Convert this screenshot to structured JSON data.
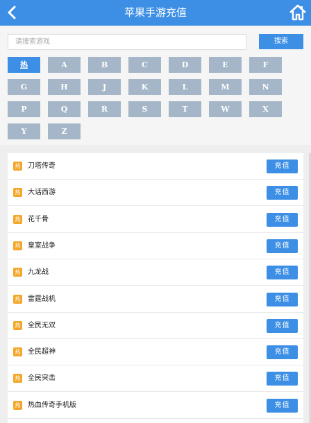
{
  "header": {
    "title": "苹果手游充值",
    "back_icon": "chevron-left-icon",
    "home_icon": "home-icon"
  },
  "search": {
    "placeholder": "请搜索游戏",
    "button_label": "搜索"
  },
  "letters": [
    "热",
    "A",
    "B",
    "C",
    "D",
    "E",
    "F",
    "G",
    "H",
    "J",
    "K",
    "L",
    "M",
    "N",
    "P",
    "Q",
    "R",
    "S",
    "T",
    "W",
    "X",
    "Y",
    "Z"
  ],
  "active_letter": "热",
  "games": {
    "hot_badge": "热",
    "recharge_label": "充值",
    "items": [
      "刀塔传奇",
      "大话西游",
      "花千骨",
      "皇室战争",
      "九龙战",
      "雷霆战机",
      "全民无双",
      "全民超神",
      "全民突击",
      "热血传奇手机版"
    ]
  },
  "colors": {
    "primary": "#3d8fe6",
    "letter_bg": "#a4b6c7",
    "hot_badge": "#f3a629"
  }
}
